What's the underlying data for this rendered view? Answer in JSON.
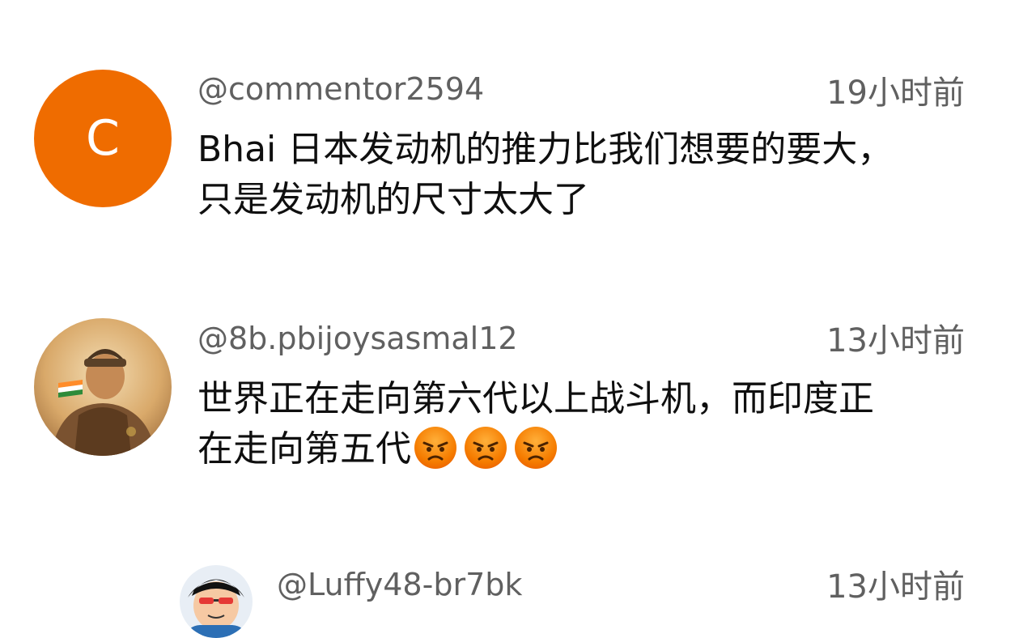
{
  "comments": [
    {
      "avatar_letter": "C",
      "avatar_color": "#ef6c00",
      "handle": "@commentor2594",
      "time": "19小时前",
      "text_line1": "Bhai 日本发动机的推力比我们想要的要大，",
      "text_line2": "只是发动机的尺寸太大了"
    },
    {
      "avatar_icon": "portrait-avatar",
      "handle": "@8b.pbijoysasmal12",
      "time": "13小时前",
      "text_line1": "世界正在走向第六代以上战斗机，而印度正",
      "text_line2": "在走向第五代",
      "emojis": [
        "angry-face-icon",
        "angry-face-icon",
        "angry-face-icon"
      ]
    },
    {
      "avatar_icon": "cartoon-avatar",
      "handle": "@Luffy48-br7bk",
      "time": "13小时前"
    }
  ]
}
